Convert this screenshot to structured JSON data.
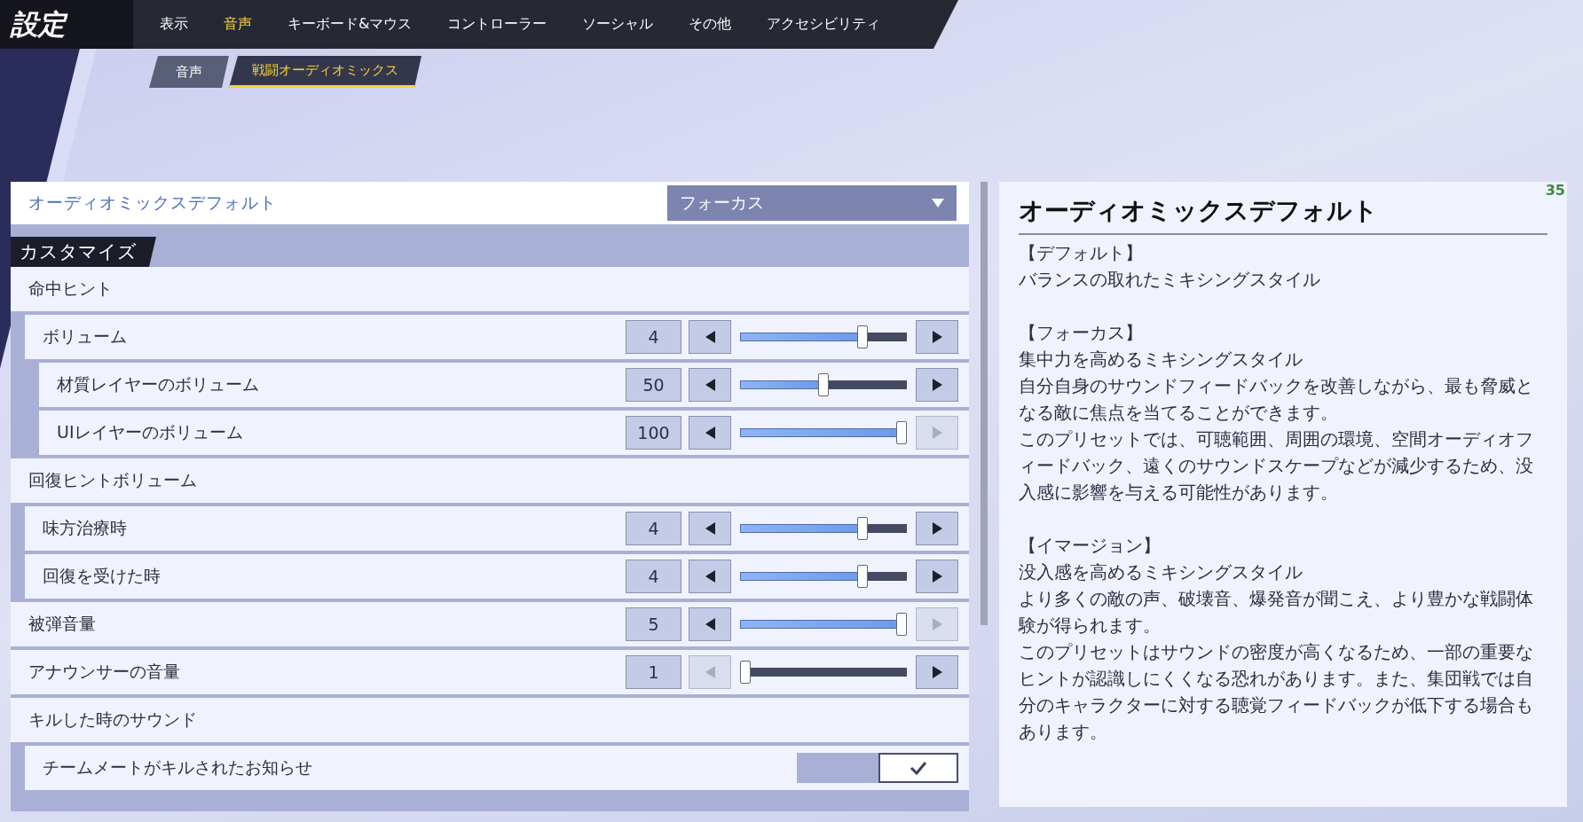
{
  "window": {
    "title": "設定"
  },
  "tabs": [
    {
      "label": "表示",
      "selected": false
    },
    {
      "label": "音声",
      "selected": true
    },
    {
      "label": "キーボード&マウス",
      "selected": false
    },
    {
      "label": "コントローラー",
      "selected": false
    },
    {
      "label": "ソーシャル",
      "selected": false
    },
    {
      "label": "その他",
      "selected": false
    },
    {
      "label": "アクセシビリティ",
      "selected": false
    }
  ],
  "subtabs": [
    {
      "label": "音声",
      "selected": false
    },
    {
      "label": "戦闘オーディオミックス",
      "selected": true
    }
  ],
  "preset": {
    "label": "オーディオミックスデフォルト",
    "value": "フォーカス"
  },
  "section": {
    "title": "カスタマイズ"
  },
  "settings": [
    {
      "kind": "group",
      "label": "命中ヒント",
      "children": [
        {
          "kind": "slider",
          "label": "ボリューム",
          "value": "4",
          "level": 0.75,
          "decrease_disabled": false,
          "increase_disabled": false,
          "children": [
            {
              "kind": "slider",
              "label": "材質レイヤーのボリューム",
              "value": "50",
              "level": 0.5,
              "decrease_disabled": false,
              "increase_disabled": false
            },
            {
              "kind": "slider",
              "label": "UIレイヤーのボリューム",
              "value": "100",
              "level": 1,
              "decrease_disabled": false,
              "increase_disabled": true
            }
          ]
        }
      ]
    },
    {
      "kind": "group",
      "label": "回復ヒントボリューム",
      "children": [
        {
          "kind": "slider",
          "label": "味方治療時",
          "value": "4",
          "level": 0.75,
          "decrease_disabled": false,
          "increase_disabled": false
        },
        {
          "kind": "slider",
          "label": "回復を受けた時",
          "value": "4",
          "level": 0.75,
          "decrease_disabled": false,
          "increase_disabled": false
        }
      ]
    },
    {
      "kind": "slider",
      "label": "被弾音量",
      "value": "5",
      "level": 1,
      "decrease_disabled": false,
      "increase_disabled": true
    },
    {
      "kind": "slider",
      "label": "アナウンサーの音量",
      "value": "1",
      "level": 0,
      "decrease_disabled": true,
      "increase_disabled": false
    },
    {
      "kind": "group",
      "label": "キルした時のサウンド",
      "children": [
        {
          "kind": "toggle",
          "label": "チームメートがキルされたお知らせ",
          "checked": true
        }
      ]
    }
  ],
  "description": {
    "title": "オーディオミックスデフォルト",
    "blocks": [
      {
        "heading": "【デフォルト】",
        "lines": [
          "バランスの取れたミキシングスタイル"
        ]
      },
      {
        "heading": "【フォーカス】",
        "lines": [
          "集中力を高めるミキシングスタイル",
          "自分自身のサウンドフィードバックを改善しながら、最も脅威となる敵に焦点を当てることができます。",
          "このプリセットでは、可聴範囲、周囲の環境、空間オーディオフィードバック、遠くのサウンドスケープなどが減少するため、没入感に影響を与える可能性があります。"
        ]
      },
      {
        "heading": "【イマージョン】",
        "lines": [
          "没入感を高めるミキシングスタイル",
          "より多くの敵の声、破壊音、爆発音が聞こえ、より豊かな戦闘体験が得られます。",
          "このプリセットはサウンドの密度が高くなるため、一部の重要なヒントが認識しにくくなる恐れがあります。また、集団戦では自分のキャラクターに対する聴覚フィードバックが低下する場合もあります。"
        ]
      }
    ]
  },
  "fps": "35"
}
